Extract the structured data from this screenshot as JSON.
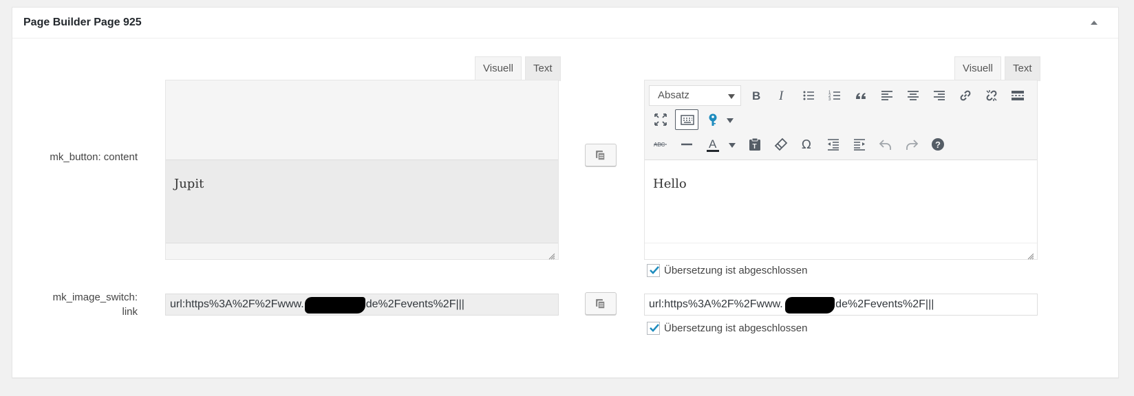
{
  "postbox": {
    "title": "Page Builder Page 925"
  },
  "fields": [
    {
      "label": "mk_button: content",
      "original": {
        "tabs": [
          "Visuell",
          "Text"
        ],
        "content": "Jupit"
      },
      "translation": {
        "tabs": [
          "Visuell",
          "Text"
        ],
        "format_select": "Absatz",
        "content": "Hello",
        "checkbox_label": "Übersetzung ist abgeschlossen",
        "checkbox_checked": true
      }
    },
    {
      "label_line1": "mk_image_switch:",
      "label_line2": "link",
      "original": {
        "value_prefix": "url:https%3A%2F%2Fwww.",
        "value_suffix": "de%2Fevents%2F|||"
      },
      "translation": {
        "value_prefix": "url:https%3A%2F%2Fwww.",
        "value_suffix": ".de%2Fevents%2F|||",
        "checkbox_label": "Übersetzung ist abgeschlossen",
        "checkbox_checked": true
      }
    }
  ],
  "toolbar": {
    "row1": [
      "bold-icon",
      "italic-icon",
      "bullet-list-icon",
      "numbered-list-icon",
      "blockquote-icon",
      "align-left-icon",
      "align-center-icon",
      "align-right-icon",
      "link-icon",
      "unlink-icon",
      "read-more-icon"
    ],
    "row2": [
      "fullscreen-icon",
      "toolbar-toggle-icon",
      "shortcode-key-icon"
    ],
    "row3": [
      "strikethrough-icon",
      "horizontal-line-icon",
      "text-color-icon",
      "paste-text-icon",
      "clear-formatting-icon",
      "special-character-icon",
      "outdent-icon",
      "indent-icon",
      "undo-icon",
      "redo-icon",
      "help-icon"
    ]
  },
  "colors": {
    "accent": "#1e8cbe",
    "icon": "#555d66",
    "disabled_icon": "#a0a5aa"
  }
}
